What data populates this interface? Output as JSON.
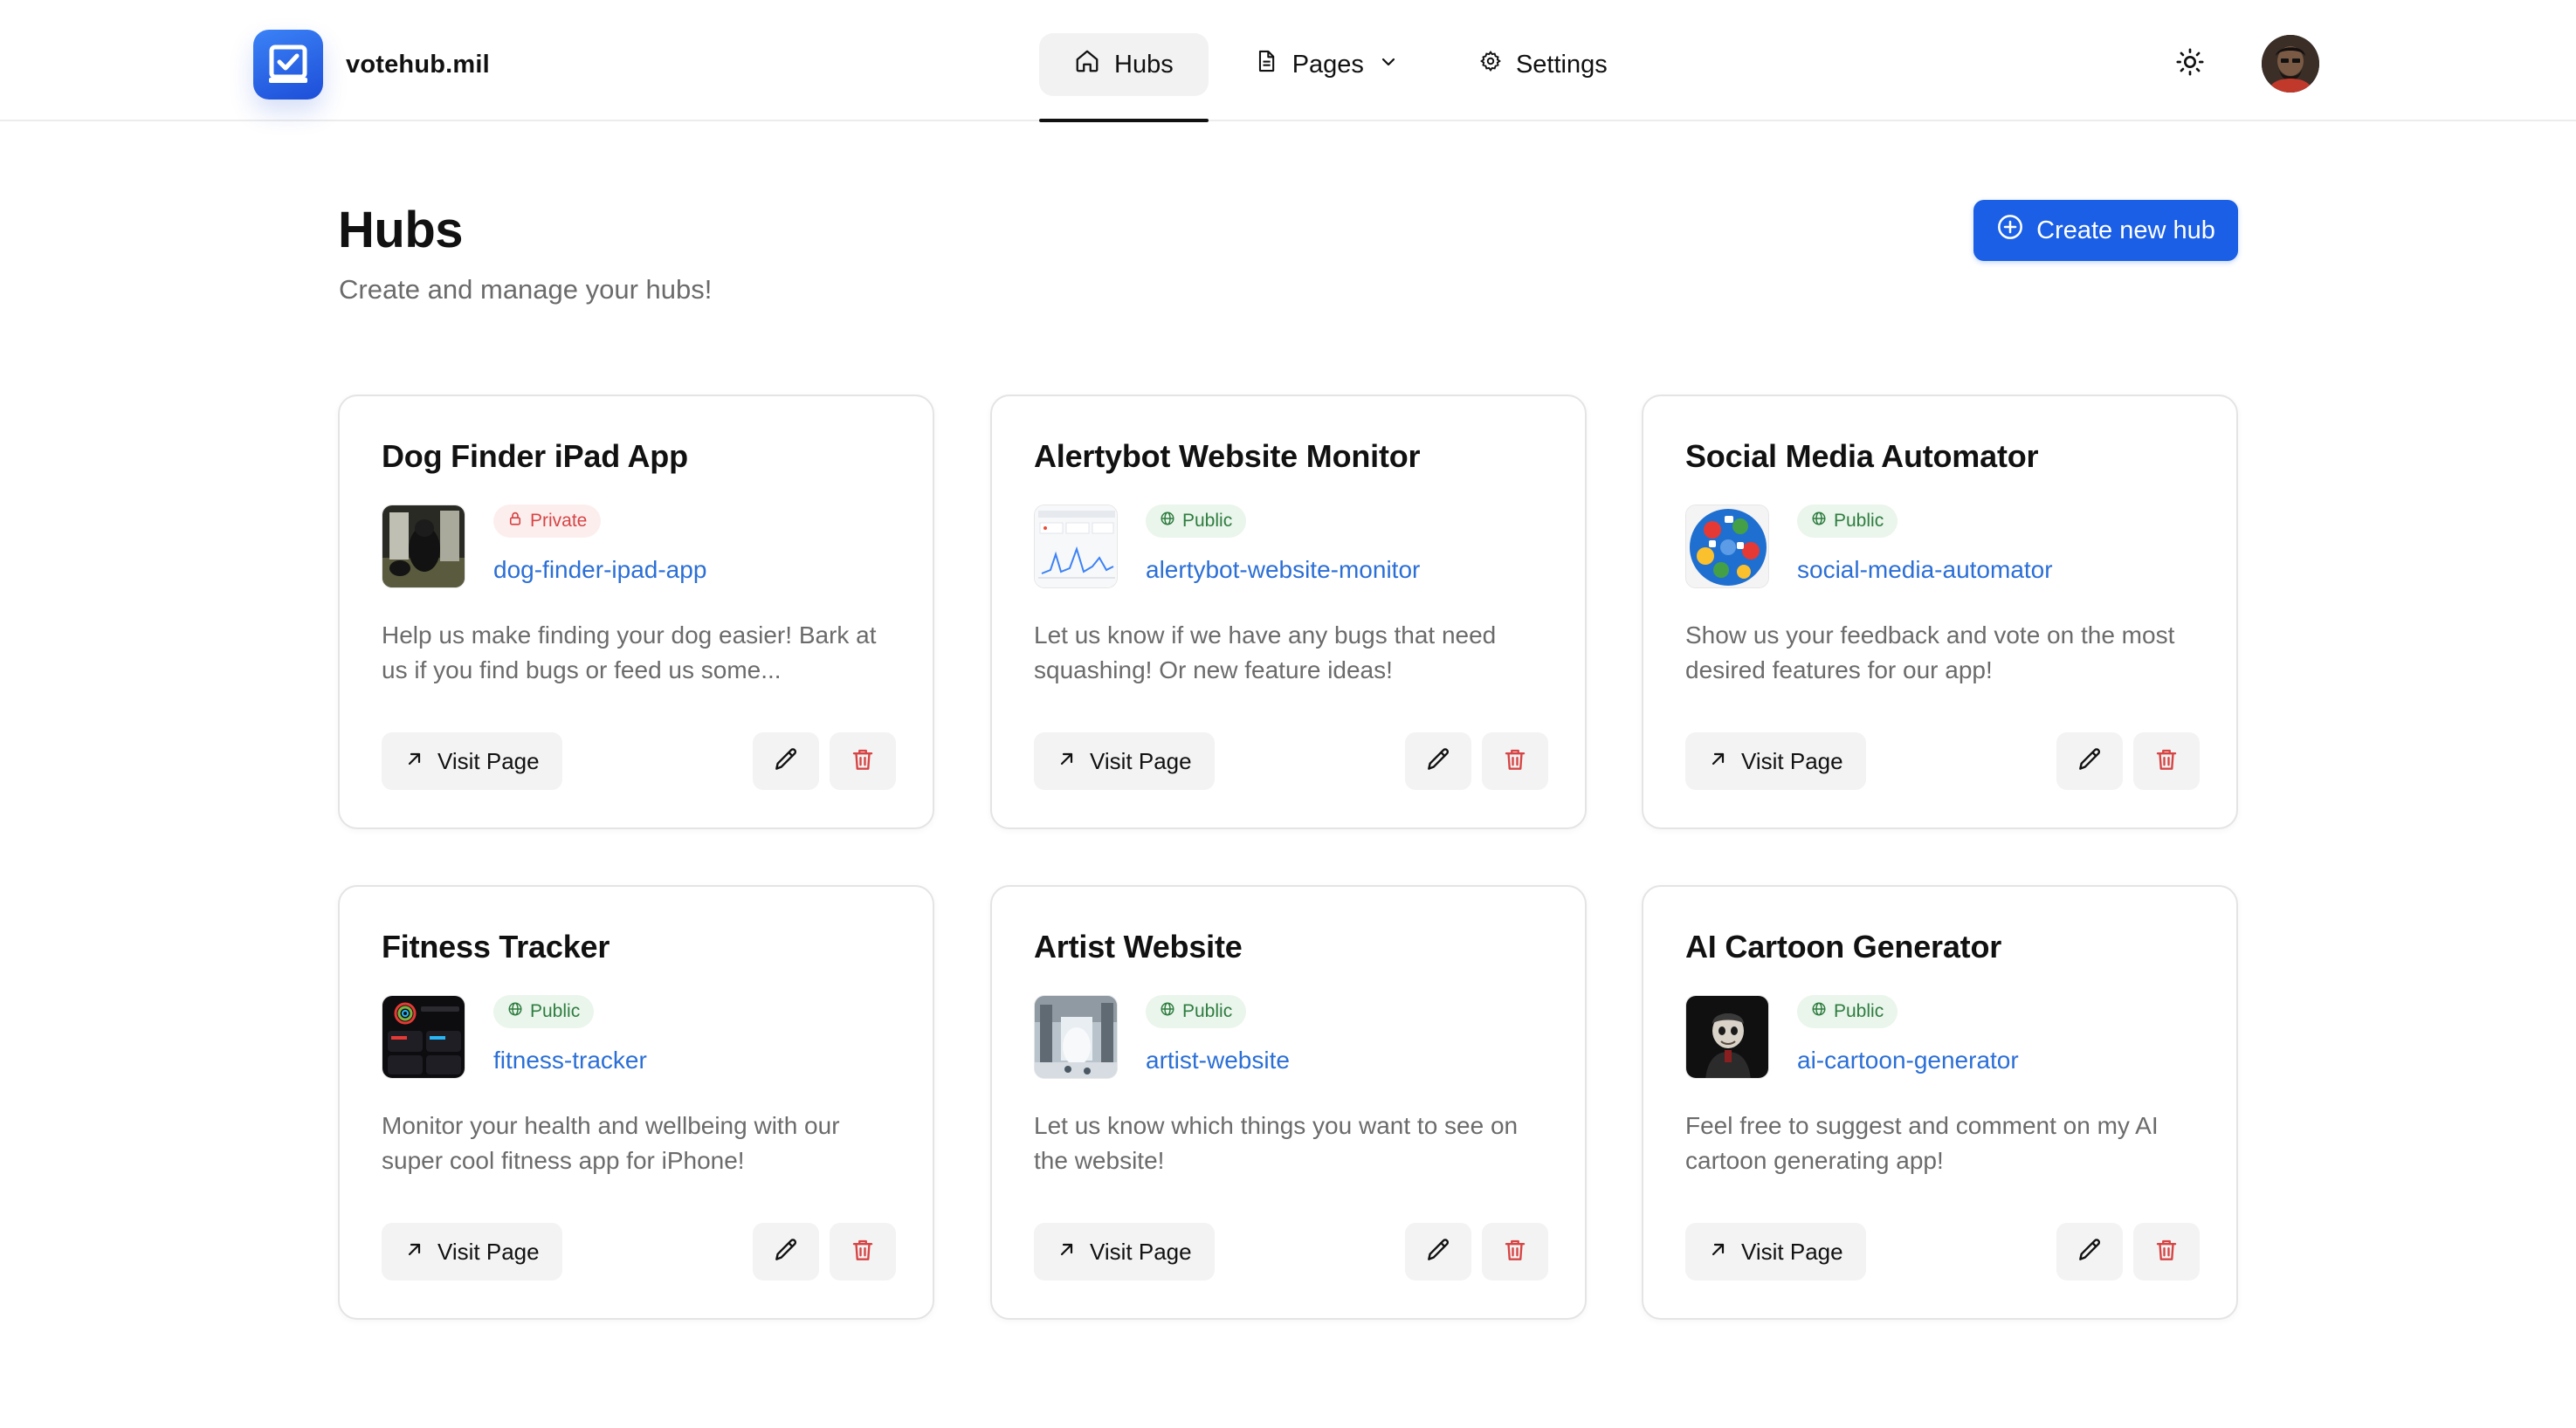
{
  "brand": {
    "name": "votehub.mil",
    "accent": "#1a5fe5"
  },
  "nav": {
    "items": [
      {
        "label": "Hubs",
        "icon": "home-icon",
        "active": true
      },
      {
        "label": "Pages",
        "icon": "document-icon",
        "dropdown": true
      },
      {
        "label": "Settings",
        "icon": "gear-icon"
      }
    ]
  },
  "header": {
    "theme_toggle_icon": "sun-icon",
    "avatar": "user-avatar"
  },
  "main": {
    "title": "Hubs",
    "subtitle": "Create and manage your hubs!",
    "create_button": "Create new hub"
  },
  "hubs": [
    {
      "title": "Dog Finder iPad App",
      "visibility": "Private",
      "slug": "dog-finder-ipad-app",
      "description": "Help us make finding your dog easier! Bark at us if you find bugs or feed us some...",
      "visit_label": "Visit Page"
    },
    {
      "title": "Alertybot Website Monitor",
      "visibility": "Public",
      "slug": "alertybot-website-monitor",
      "description": "Let us know if we have any bugs that need squashing! Or new feature ideas!",
      "visit_label": "Visit Page"
    },
    {
      "title": "Social Media Automator",
      "visibility": "Public",
      "slug": "social-media-automator",
      "description": "Show us your feedback and vote on the most desired features for our app!",
      "visit_label": "Visit Page"
    },
    {
      "title": "Fitness Tracker",
      "visibility": "Public",
      "slug": "fitness-tracker",
      "description": "Monitor your health and wellbeing with our super cool fitness app for iPhone!",
      "visit_label": "Visit Page"
    },
    {
      "title": "Artist Website",
      "visibility": "Public",
      "slug": "artist-website",
      "description": "Let us know which things you want to see on the website!",
      "visit_label": "Visit Page"
    },
    {
      "title": "AI Cartoon Generator",
      "visibility": "Public",
      "slug": "ai-cartoon-generator",
      "description": "Feel free to suggest and comment on my AI cartoon generating app!",
      "visit_label": "Visit Page"
    }
  ]
}
